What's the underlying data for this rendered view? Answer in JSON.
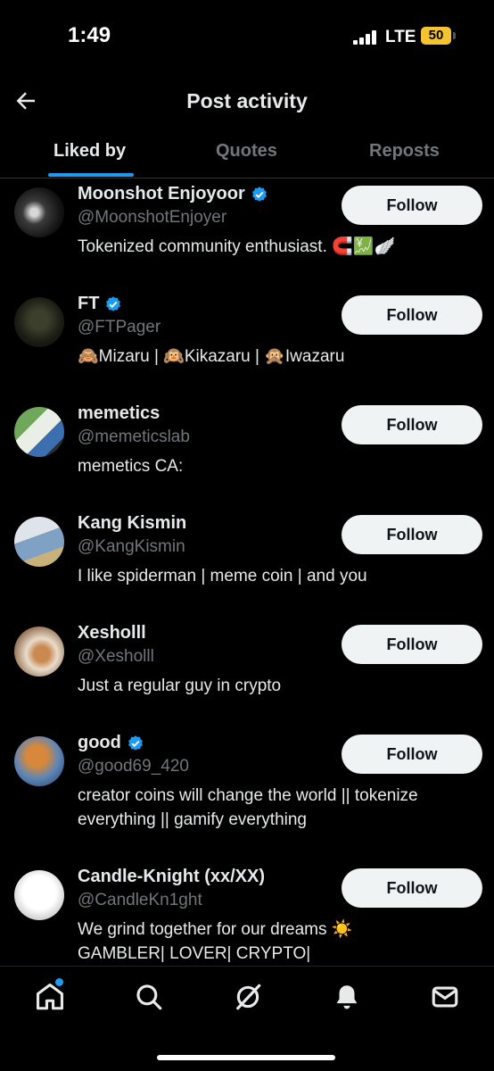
{
  "status": {
    "time": "1:49",
    "network": "LTE",
    "battery": "50"
  },
  "header": {
    "title": "Post activity"
  },
  "tabs": [
    {
      "label": "Liked by",
      "active": true
    },
    {
      "label": "Quotes",
      "active": false
    },
    {
      "label": "Reposts",
      "active": false
    }
  ],
  "users": [
    {
      "name": "Moonshot Enjoyoor",
      "handle": "@MoonshotEnjoyer",
      "verified": true,
      "bio": [
        "Tokenized community enthusiast. 🧲💹🪽"
      ],
      "follow": "Follow"
    },
    {
      "name": "FT",
      "handle": "@FTPager",
      "verified": true,
      "bio": [
        "🙈Mizaru | 🙉Kikazaru | 🙊Iwazaru"
      ],
      "follow": "Follow"
    },
    {
      "name": "memetics",
      "handle": "@memeticslab",
      "verified": false,
      "bio": [
        "memetics CA:"
      ],
      "follow": "Follow"
    },
    {
      "name": "Kang Kismin",
      "handle": "@KangKismin",
      "verified": false,
      "bio": [
        "I like spiderman | meme coin | and you"
      ],
      "follow": "Follow"
    },
    {
      "name": "Xesholll",
      "handle": "@Xesholll",
      "verified": false,
      "bio": [
        "Just a regular guy in crypto"
      ],
      "follow": "Follow"
    },
    {
      "name": "good",
      "handle": "@good69_420",
      "verified": true,
      "bio": [
        "creator coins will change the world || tokenize",
        "everything || gamify everything"
      ],
      "follow": "Follow"
    },
    {
      "name": "Candle-Knight (xx/XX)",
      "handle": "@CandleKn1ght",
      "verified": false,
      "bio": [
        "We grind together for our dreams ☀️",
        "GAMBLER| LOVER| CRYPTO|"
      ],
      "follow": "Follow"
    }
  ],
  "nav": [
    "home-icon",
    "search-icon",
    "grok-icon",
    "notifications-icon",
    "messages-icon"
  ],
  "colors": {
    "accent": "#1d9bf0",
    "background": "#000000",
    "muted": "#71767b",
    "button": "#eff3f4"
  }
}
